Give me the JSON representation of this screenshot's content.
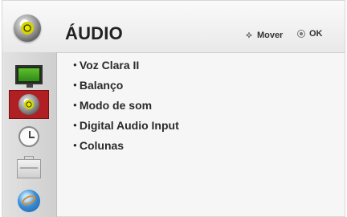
{
  "header": {
    "title": "ÁUDIO",
    "icon": "speaker-icon",
    "hint_move": "Mover",
    "hint_ok": "OK"
  },
  "sidebar": {
    "items": [
      {
        "icon": "tv-screen-icon",
        "active": false
      },
      {
        "icon": "speaker-icon",
        "active": true
      },
      {
        "icon": "clock-icon",
        "active": false
      },
      {
        "icon": "toolbox-icon",
        "active": false
      },
      {
        "icon": "globe-icon",
        "active": false
      }
    ]
  },
  "menu": {
    "items": [
      {
        "label": "Voz Clara II"
      },
      {
        "label": "Balanço"
      },
      {
        "label": "Modo de som"
      },
      {
        "label": "Digital Audio Input"
      },
      {
        "label": "Colunas"
      }
    ]
  },
  "colors": {
    "active_highlight": "#b01f24",
    "panel_bg": "#f6f6f6"
  }
}
